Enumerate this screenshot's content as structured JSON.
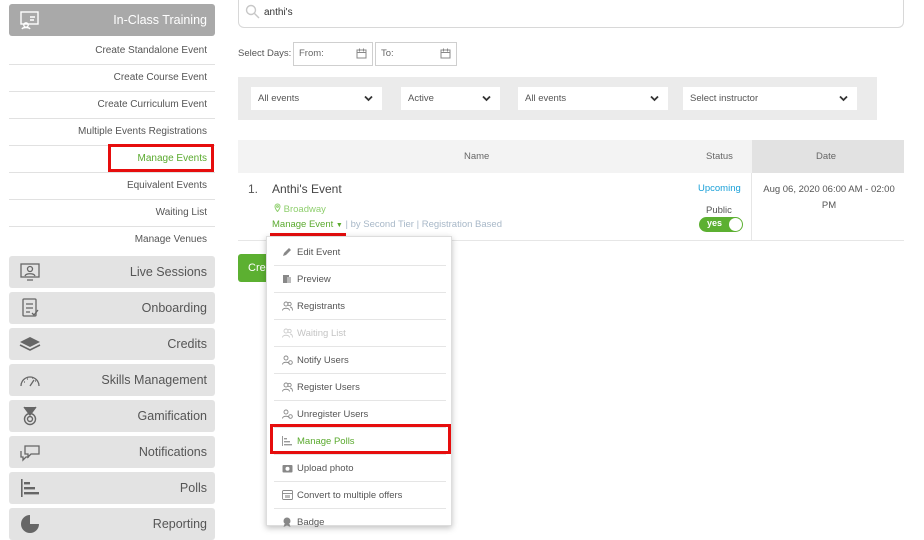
{
  "sidebar": {
    "in_class_training": "In-Class Training",
    "sub_items": [
      "Create Standalone Event",
      "Create Course Event",
      "Create Curriculum Event",
      "Multiple Events Registrations",
      "Manage Events",
      "Equivalent Events",
      "Waiting List",
      "Manage Venues"
    ],
    "modules": [
      "Live Sessions",
      "Onboarding",
      "Credits",
      "Skills Management",
      "Gamification",
      "Notifications",
      "Polls",
      "Reporting"
    ]
  },
  "search": {
    "value": "anthi's"
  },
  "date_filter": {
    "label": "Select Days:",
    "from_placeholder": "From:",
    "to_placeholder": "To:"
  },
  "filters": [
    "All events",
    "Active",
    "All events",
    "Select instructor"
  ],
  "table": {
    "headers": {
      "name": "Name",
      "status": "Status",
      "date": "Date"
    },
    "row": {
      "number": "1.",
      "name": "Anthi's Event",
      "location": "Broadway",
      "manage_link": "Manage Event",
      "meta": "| by Second Tier | Registration Based",
      "status": "Upcoming",
      "visibility": "Public",
      "toggle": "yes",
      "date": "Aug 06, 2020 06:00 AM - 02:00 PM"
    }
  },
  "create_button": "Crea",
  "dropdown": [
    "Edit Event",
    "Preview",
    "Registrants",
    "Waiting List",
    "Notify Users",
    "Register Users",
    "Unregister Users",
    "Manage Polls",
    "Upload photo",
    "Convert to multiple offers",
    "Badge"
  ],
  "colors": {
    "accent_green": "#5cb031",
    "link_blue": "#1aa0d8",
    "highlight_red": "#e60d0d"
  }
}
